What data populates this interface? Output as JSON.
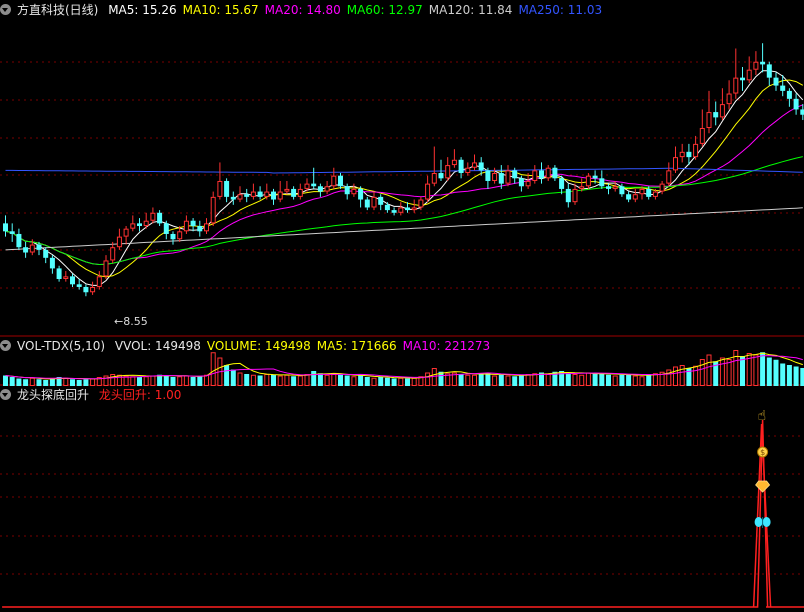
{
  "main": {
    "title": "方直科技(日线)",
    "ma_labels": [
      {
        "text": "MA5: 15.26",
        "color": "#ffffff"
      },
      {
        "text": "MA10: 15.67",
        "color": "#ffff00"
      },
      {
        "text": "MA20: 14.80",
        "color": "#ff00ff"
      },
      {
        "text": "MA60: 12.97",
        "color": "#00ff00"
      },
      {
        "text": "MA120: 11.84",
        "color": "#cccccc"
      },
      {
        "text": "MA250: 11.03",
        "color": "#3355ff"
      }
    ],
    "low_marker": "8.55"
  },
  "volume": {
    "title": "VOL-TDX(5,10)",
    "labels": [
      {
        "text": "VVOL: 149498",
        "color": "#e6e6e6"
      },
      {
        "text": "VOLUME: 149498",
        "color": "#ffff00"
      },
      {
        "text": "MA5: 171666",
        "color": "#ffff00"
      },
      {
        "text": "MA10: 221273",
        "color": "#ff00ff"
      }
    ]
  },
  "indicator": {
    "title": "龙头探底回升",
    "labels": [
      {
        "text": "龙头回升: 1.00",
        "color": "#ff2020"
      }
    ]
  },
  "colors": {
    "up": "#ff3232",
    "down": "#54ffff",
    "grid": "#7a0000",
    "divider": "#a00000"
  },
  "chart_data": {
    "type": "candlestick",
    "candles": [
      [
        11.3,
        11.0,
        11.6,
        10.8
      ],
      [
        11.0,
        10.9,
        11.3,
        10.6
      ],
      [
        10.9,
        10.4,
        11.1,
        10.3
      ],
      [
        10.4,
        10.2,
        10.6,
        10.0
      ],
      [
        10.2,
        10.5,
        10.7,
        10.1
      ],
      [
        10.5,
        10.3,
        10.6,
        10.1
      ],
      [
        10.3,
        10.0,
        10.4,
        9.8
      ],
      [
        10.0,
        9.6,
        10.1,
        9.4
      ],
      [
        9.6,
        9.2,
        9.7,
        9.1
      ],
      [
        9.2,
        9.3,
        9.5,
        9.1
      ],
      [
        9.3,
        9.0,
        9.4,
        8.9
      ],
      [
        9.0,
        8.9,
        9.2,
        8.8
      ],
      [
        8.9,
        8.7,
        9.0,
        8.55
      ],
      [
        8.7,
        8.9,
        9.1,
        8.6
      ],
      [
        8.9,
        9.3,
        9.5,
        8.8
      ],
      [
        9.3,
        9.9,
        10.1,
        9.2
      ],
      [
        9.9,
        10.4,
        10.6,
        9.8
      ],
      [
        10.4,
        10.8,
        11.1,
        10.3
      ],
      [
        10.8,
        11.1,
        11.2,
        10.5
      ],
      [
        11.1,
        11.3,
        11.6,
        11.0
      ],
      [
        11.3,
        11.2,
        11.5,
        11.0
      ],
      [
        11.2,
        11.4,
        11.7,
        11.1
      ],
      [
        11.4,
        11.7,
        11.9,
        11.3
      ],
      [
        11.7,
        11.3,
        11.8,
        11.2
      ],
      [
        11.3,
        10.9,
        11.4,
        10.7
      ],
      [
        10.9,
        10.7,
        11.0,
        10.5
      ],
      [
        10.7,
        11.0,
        11.2,
        10.6
      ],
      [
        11.0,
        11.4,
        11.6,
        10.9
      ],
      [
        11.4,
        11.2,
        11.5,
        11.0
      ],
      [
        11.2,
        11.0,
        11.4,
        10.8
      ],
      [
        11.0,
        11.3,
        11.5,
        10.9
      ],
      [
        11.3,
        12.3,
        12.5,
        11.2
      ],
      [
        12.3,
        12.9,
        13.6,
        12.2
      ],
      [
        12.9,
        12.3,
        13.0,
        12.1
      ],
      [
        12.3,
        12.2,
        12.5,
        12.0
      ],
      [
        12.2,
        12.4,
        12.7,
        12.1
      ],
      [
        12.4,
        12.3,
        12.6,
        12.1
      ],
      [
        12.3,
        12.5,
        12.8,
        12.2
      ],
      [
        12.5,
        12.3,
        12.7,
        12.2
      ],
      [
        12.3,
        12.5,
        12.8,
        12.2
      ],
      [
        12.5,
        12.2,
        12.6,
        12.0
      ],
      [
        12.2,
        12.5,
        12.9,
        12.1
      ],
      [
        12.5,
        12.6,
        12.9,
        12.4
      ],
      [
        12.6,
        12.3,
        12.7,
        12.2
      ],
      [
        12.3,
        12.6,
        12.8,
        12.2
      ],
      [
        12.6,
        12.8,
        13.0,
        12.5
      ],
      [
        12.8,
        12.7,
        13.4,
        12.6
      ],
      [
        12.7,
        12.5,
        12.8,
        12.3
      ],
      [
        12.5,
        12.7,
        12.9,
        12.4
      ],
      [
        12.7,
        13.1,
        13.4,
        12.6
      ],
      [
        13.1,
        12.7,
        13.2,
        12.6
      ],
      [
        12.7,
        12.4,
        12.8,
        12.2
      ],
      [
        12.4,
        12.6,
        12.8,
        12.3
      ],
      [
        12.6,
        12.2,
        12.7,
        11.9
      ],
      [
        12.2,
        11.9,
        12.3,
        11.8
      ],
      [
        11.9,
        12.3,
        12.5,
        11.8
      ],
      [
        12.3,
        12.0,
        12.4,
        11.8
      ],
      [
        12.0,
        11.8,
        12.1,
        11.7
      ],
      [
        11.8,
        11.7,
        11.9,
        11.6
      ],
      [
        11.7,
        11.9,
        12.1,
        11.6
      ],
      [
        11.9,
        11.8,
        12.1,
        11.7
      ],
      [
        11.8,
        11.9,
        12.2,
        11.7
      ],
      [
        11.9,
        12.2,
        12.3,
        11.8
      ],
      [
        12.2,
        12.8,
        13.1,
        12.1
      ],
      [
        12.8,
        13.2,
        14.2,
        12.7
      ],
      [
        13.2,
        13.0,
        13.7,
        12.9
      ],
      [
        13.0,
        13.5,
        13.8,
        12.9
      ],
      [
        13.5,
        13.7,
        14.1,
        13.4
      ],
      [
        13.7,
        13.2,
        13.8,
        13.0
      ],
      [
        13.2,
        13.4,
        13.6,
        13.1
      ],
      [
        13.4,
        13.6,
        13.9,
        13.3
      ],
      [
        13.6,
        13.3,
        13.8,
        13.1
      ],
      [
        13.3,
        12.9,
        13.4,
        12.6
      ],
      [
        12.9,
        13.2,
        13.4,
        12.8
      ],
      [
        13.2,
        12.8,
        13.5,
        12.6
      ],
      [
        12.8,
        13.3,
        13.5,
        12.7
      ],
      [
        13.3,
        13.0,
        13.4,
        12.8
      ],
      [
        13.0,
        12.7,
        13.1,
        12.5
      ],
      [
        12.7,
        12.9,
        13.2,
        12.6
      ],
      [
        12.9,
        13.3,
        13.5,
        12.8
      ],
      [
        13.3,
        13.0,
        13.6,
        12.8
      ],
      [
        13.0,
        13.4,
        13.5,
        12.9
      ],
      [
        13.4,
        13.0,
        13.5,
        12.9
      ],
      [
        13.0,
        12.6,
        13.1,
        12.4
      ],
      [
        12.6,
        12.1,
        12.8,
        11.9
      ],
      [
        12.1,
        12.6,
        12.8,
        12.0
      ],
      [
        12.6,
        12.7,
        13.0,
        12.5
      ],
      [
        12.7,
        13.1,
        13.2,
        12.6
      ],
      [
        13.1,
        13.0,
        13.3,
        12.8
      ],
      [
        13.0,
        12.7,
        13.3,
        12.6
      ],
      [
        12.7,
        12.6,
        12.8,
        12.4
      ],
      [
        12.6,
        12.7,
        12.9,
        12.5
      ],
      [
        12.7,
        12.4,
        12.8,
        12.3
      ],
      [
        12.4,
        12.2,
        12.5,
        12.1
      ],
      [
        12.2,
        12.4,
        12.6,
        12.1
      ],
      [
        12.4,
        12.6,
        12.7,
        12.2
      ],
      [
        12.6,
        12.3,
        12.7,
        12.2
      ],
      [
        12.3,
        12.5,
        12.6,
        12.2
      ],
      [
        12.5,
        12.8,
        12.9,
        12.4
      ],
      [
        12.8,
        13.3,
        13.6,
        12.7
      ],
      [
        13.3,
        13.8,
        14.2,
        13.2
      ],
      [
        13.8,
        14.0,
        14.3,
        13.6
      ],
      [
        14.0,
        13.8,
        14.3,
        13.5
      ],
      [
        13.8,
        14.3,
        14.6,
        13.7
      ],
      [
        14.3,
        14.9,
        15.6,
        14.2
      ],
      [
        14.9,
        15.5,
        16.3,
        14.7
      ],
      [
        15.5,
        15.3,
        15.9,
        15.0
      ],
      [
        15.3,
        15.8,
        16.4,
        15.2
      ],
      [
        15.8,
        16.2,
        16.7,
        15.6
      ],
      [
        16.2,
        16.8,
        17.9,
        16.0
      ],
      [
        16.8,
        16.7,
        17.2,
        16.3
      ],
      [
        16.7,
        17.1,
        17.6,
        16.6
      ],
      [
        17.1,
        17.4,
        17.8,
        16.9
      ],
      [
        17.4,
        17.3,
        18.1,
        17.0
      ],
      [
        17.3,
        16.8,
        17.4,
        16.5
      ],
      [
        16.8,
        16.5,
        17.0,
        16.3
      ],
      [
        16.5,
        16.3,
        16.9,
        16.1
      ],
      [
        16.3,
        16.0,
        16.4,
        15.7
      ],
      [
        16.0,
        15.6,
        16.2,
        15.4
      ],
      [
        15.6,
        15.4,
        15.8,
        15.2
      ]
    ],
    "volumes": [
      14,
      12,
      10,
      9,
      11,
      9,
      8,
      10,
      12,
      11,
      9,
      8,
      9,
      10,
      12,
      14,
      16,
      15,
      14,
      13,
      12,
      13,
      14,
      15,
      14,
      12,
      13,
      14,
      12,
      13,
      15,
      45,
      38,
      28,
      22,
      18,
      16,
      15,
      14,
      16,
      15,
      14,
      15,
      13,
      14,
      16,
      20,
      17,
      15,
      16,
      15,
      14,
      13,
      14,
      12,
      11,
      12,
      11,
      10,
      11,
      10,
      11,
      13,
      18,
      24,
      19,
      17,
      18,
      16,
      15,
      15,
      16,
      17,
      14,
      15,
      14,
      13,
      15,
      16,
      17,
      18,
      16,
      19,
      20,
      17,
      16,
      15,
      18,
      17,
      16,
      15,
      14,
      15,
      16,
      14,
      13,
      15,
      17,
      19,
      22,
      26,
      28,
      24,
      27,
      36,
      42,
      33,
      38,
      36,
      48,
      40,
      44,
      42,
      45,
      38,
      35,
      30,
      28,
      26,
      24
    ],
    "signal": {
      "index": 113,
      "value": 1.0
    },
    "price_range": [
      7.2,
      18.9
    ]
  }
}
